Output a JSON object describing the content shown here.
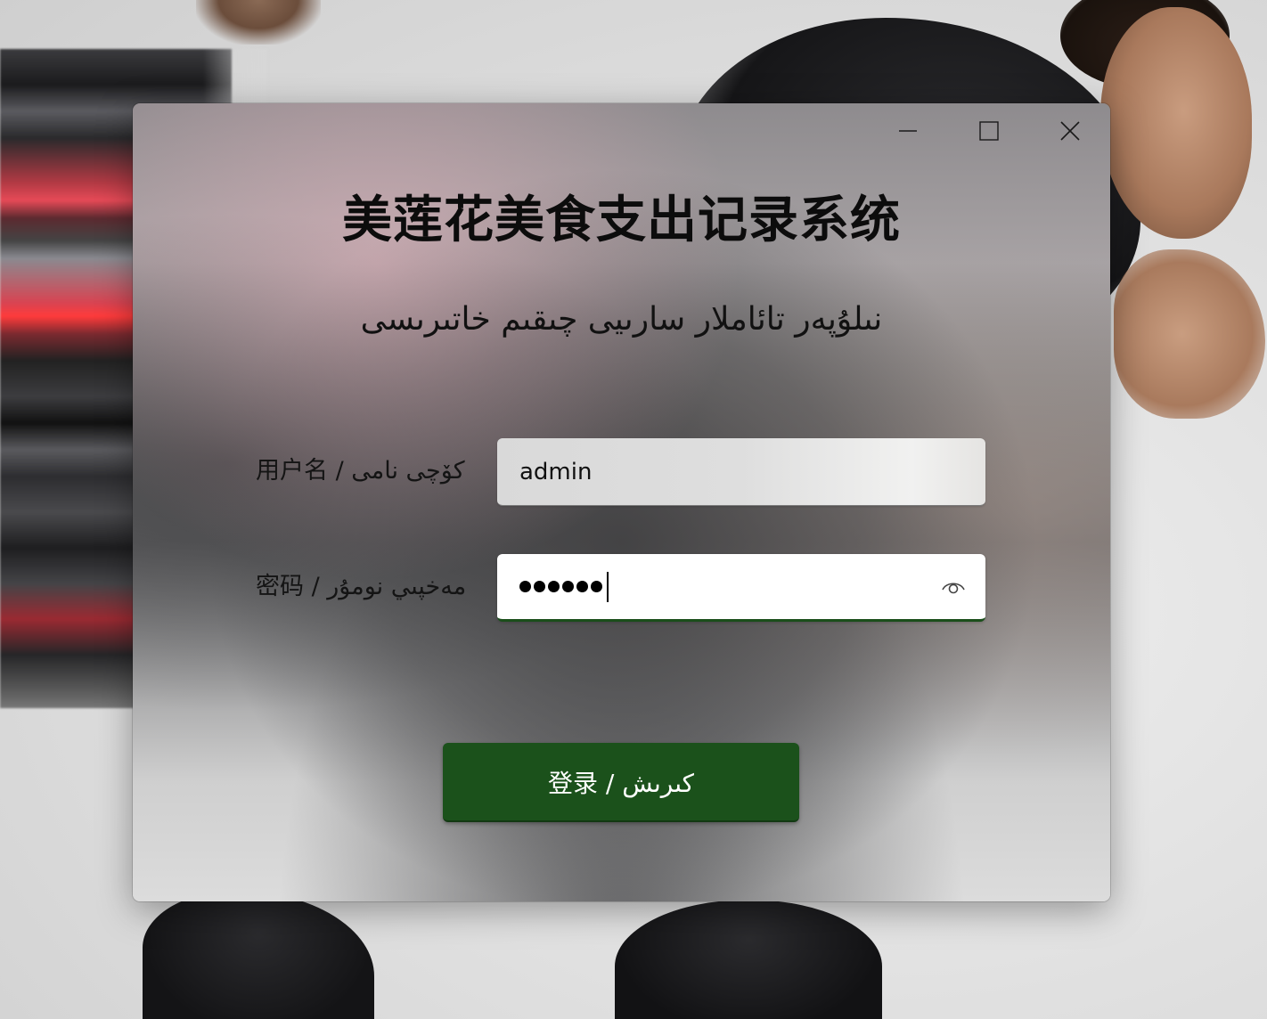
{
  "app": {
    "title": "美莲花美食支出记录系统",
    "subtitle": "نىلۇپەر تائاملار سارىيى چىقىم خاتىرىسى"
  },
  "window_controls": {
    "minimize_icon": "minimize-icon",
    "maximize_icon": "maximize-icon",
    "close_icon": "close-icon"
  },
  "form": {
    "username_label": "用户名 / كۆچى نامى",
    "username_value": "admin",
    "password_label": "密码 / مەخپىي نومۇر",
    "password_length": 6,
    "reveal_icon": "eye-icon",
    "login_label": "登录 / كىرىش"
  },
  "colors": {
    "accent": "#1b511b",
    "focus_underline": "#1a4e1a",
    "button_text": "#ffffff"
  }
}
